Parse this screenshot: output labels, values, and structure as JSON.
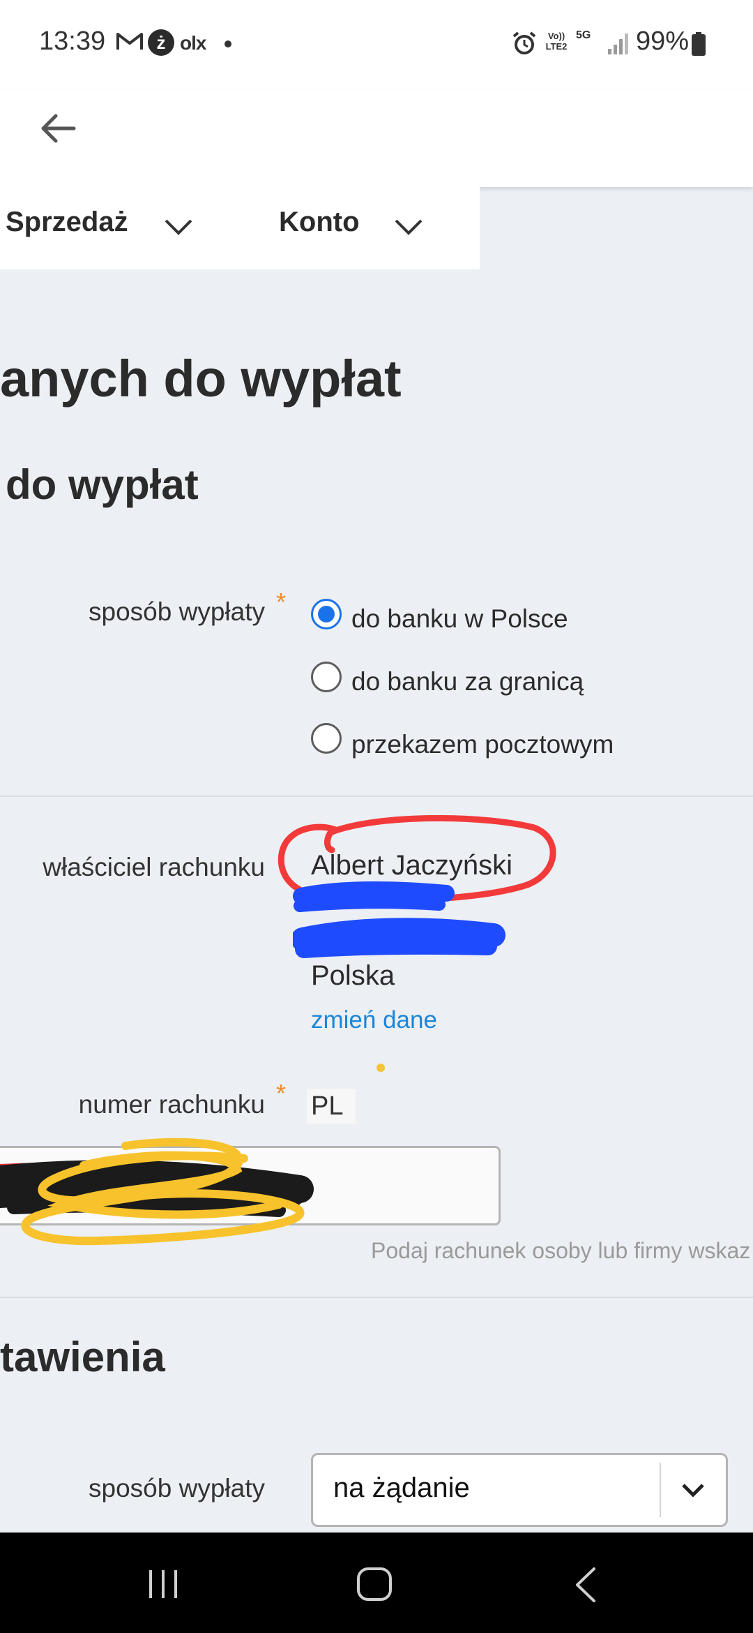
{
  "status_bar": {
    "time": "13:39",
    "notification_icons": [
      "gmail-icon",
      "z-app-icon",
      "olx-icon",
      "more-dot"
    ],
    "olx_text": "olx",
    "z_text": "ż",
    "volte_text": "Vo)) LTE2",
    "network": "5G",
    "battery": "99%"
  },
  "nav_tabs": {
    "sales": "Sprzedaż",
    "account": "Konto"
  },
  "page": {
    "title_partial": "anych do wypłat",
    "section_title_partial": "do wypłat"
  },
  "payout_method": {
    "label": "sposób wypłaty",
    "required": "*",
    "options": [
      {
        "label": "do banku w Polsce",
        "selected": true
      },
      {
        "label": "do banku za granicą",
        "selected": false
      },
      {
        "label": "przekazem pocztowym",
        "selected": false
      }
    ]
  },
  "account_owner": {
    "label": "właściciel rachunku",
    "name": "Albert Jaczyński",
    "country": "Polska",
    "change_link": "zmień dane"
  },
  "account_number": {
    "label": "numer rachunku",
    "required": "*",
    "prefix": "PL",
    "hint": "Podaj rachunek osoby lub firmy wskaz"
  },
  "settings": {
    "title_partial": "tawienia",
    "payout_label": "sposób wypłaty",
    "payout_value": "na żądanie"
  },
  "colors": {
    "accent": "#1a73e8",
    "link": "#1a86d8",
    "required": "#f08a24",
    "background": "#eceff3"
  }
}
